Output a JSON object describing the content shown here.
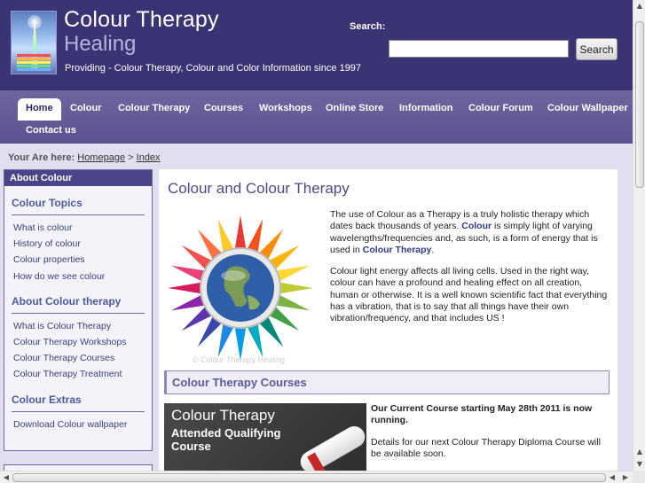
{
  "header": {
    "title": "Colour Therapy",
    "subtitle": "Healing",
    "tagline": "Providing - Colour Therapy, Colour and Color Information since 1997",
    "search_label": "Search:",
    "search_value": "",
    "search_button": "Search"
  },
  "nav": {
    "items": [
      "Home",
      "Colour",
      "Colour Therapy",
      "Courses",
      "Workshops",
      "Online Store",
      "Information",
      "Colour Forum",
      "Colour Wallpaper",
      "Contact us"
    ],
    "active": "Home"
  },
  "breadcrumb": {
    "label": "Your Are here:",
    "items": [
      "Homepage",
      "Index"
    ],
    "separator": ">"
  },
  "sidebar": {
    "header": "About Colour",
    "sections": [
      {
        "title": "Colour Topics",
        "links": [
          "What is colour",
          "History of colour",
          "Colour properties",
          "How do we see colour"
        ]
      },
      {
        "title": "About Colour therapy",
        "links": [
          "What is Colour Therapy",
          "Colour Therapy Workshops",
          "Colour Therapy Courses",
          "Colour Therapy Treatment"
        ]
      },
      {
        "title": "Colour Extras",
        "links": [
          "Download Colour wallpaper"
        ]
      }
    ]
  },
  "main": {
    "title": "Colour and Colour Therapy",
    "intro_p1_a": "The use of Colour as a Therapy is a truly holistic therapy which dates back thousands of years. ",
    "intro_p1_b": "Colour",
    "intro_p1_c": " is simply light of varying wavelengths/frequencies and, as such, is a form of energy that is used in ",
    "intro_p1_d": "Colour Therapy",
    "intro_p1_e": ".",
    "intro_p2": "Colour light energy affects all living cells. Used in the right way, colour can have a profound and healing effect on all creation, human or otherwise. It is a well known scientific fact that everything has a vibration, that is to say that all things have their own vibration/frequency, and that includes US !",
    "image_caption": "© Colour Therapy Healing",
    "courses_heading": "Colour Therapy Courses",
    "banner_line1": "Colour Therapy",
    "banner_line2": "Attended Qualifying",
    "banner_line3": "Course",
    "course_highlight": "Our Current Course starting May 28th 2011 is now running.",
    "course_details": "Details for our next Colour Therapy Diploma Course will be available soon."
  },
  "colors": {
    "header_bg": "#3b3474",
    "nav_bg": "#5f5895",
    "page_bg": "#e2def0",
    "accent_text": "#4e4a8a"
  }
}
